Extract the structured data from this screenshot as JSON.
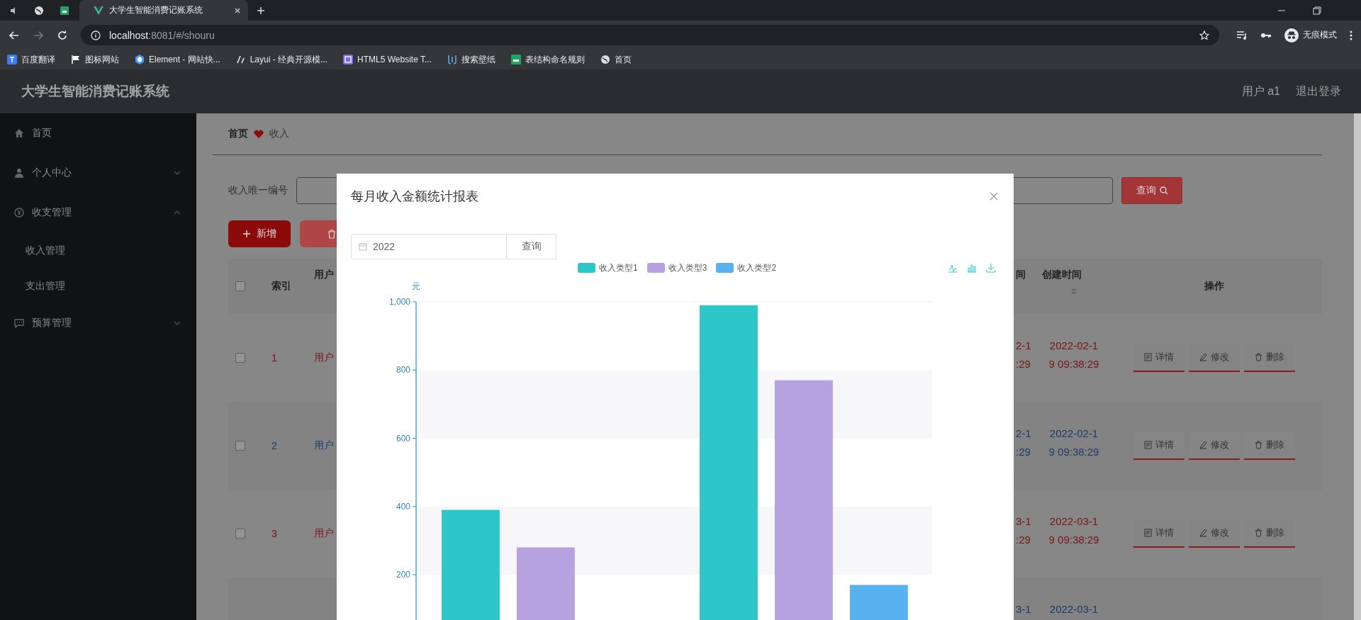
{
  "browser": {
    "tabs": [
      {
        "title": "大学生智能消费记账系统",
        "selected": true
      }
    ],
    "address": {
      "host": "localhost",
      "path": ":8081/#/shouru"
    },
    "profile": "无痕模式",
    "bookmarks": [
      {
        "label": "百度翻译",
        "kind": "translate"
      },
      {
        "label": "图标网站",
        "kind": "flag"
      },
      {
        "label": "Element - 网站快...",
        "kind": "hexagon"
      },
      {
        "label": "Layui - 经典开源模...",
        "kind": "slashes"
      },
      {
        "label": "HTML5 Website T...",
        "kind": "square"
      },
      {
        "label": "搜索壁纸",
        "kind": "brackets"
      },
      {
        "label": "表结构命名规则",
        "kind": "sheet"
      },
      {
        "label": "首页",
        "kind": "globe"
      }
    ]
  },
  "app": {
    "title": "大学生智能消费记账系统",
    "user": "用户 a1",
    "logout": "退出登录"
  },
  "sidebar": {
    "items": [
      {
        "label": "首页",
        "kind": "home"
      },
      {
        "label": "个人中心",
        "kind": "user",
        "expanded": false
      },
      {
        "label": "收支管理",
        "kind": "coin",
        "expanded": true,
        "children": [
          {
            "label": "收入管理"
          },
          {
            "label": "支出管理"
          }
        ]
      },
      {
        "label": "预算管理",
        "kind": "chat",
        "expanded": false
      }
    ]
  },
  "breadcrumb": [
    "首页",
    "收入"
  ],
  "search": {
    "label": "收入唯一编号",
    "button": "查询"
  },
  "toolbar": {
    "add": "新增"
  },
  "table": {
    "all_checked": false,
    "columns": [
      "索引",
      "用户",
      "间",
      "创建时间",
      "操作"
    ],
    "rows": [
      {
        "checked": false,
        "index": "1",
        "user": "用户",
        "time_end": [
          "2-1",
          ":29"
        ],
        "created": [
          "2022-02-1",
          "9 09:38:29"
        ],
        "color": "#7a1414",
        "actions": [
          "详情",
          "修改",
          "删除"
        ]
      },
      {
        "checked": false,
        "index": "2",
        "user": "用户",
        "time_end": [
          "2-1",
          ":29"
        ],
        "created": [
          "2022-02-1",
          "9 09:38:29"
        ],
        "color": "#1d3a6b",
        "actions": [
          "详情",
          "修改",
          "删除"
        ]
      },
      {
        "checked": false,
        "index": "3",
        "user": "用户",
        "time_end": [
          "3-1",
          ":29"
        ],
        "created": [
          "2022-03-1",
          "9 09:38:29"
        ],
        "color": "#7a1414",
        "actions": [
          "详情",
          "修改",
          "删除"
        ]
      },
      {
        "time_end": [
          "3-1"
        ],
        "created": [
          "2022-03-1"
        ],
        "color": "#1d3a6b"
      }
    ]
  },
  "modal": {
    "title": "每月收入金额统计报表",
    "year": "2022",
    "query": "查询",
    "chart_data": {
      "type": "bar",
      "stacked": false,
      "ylabel": "元",
      "ylim": [
        0,
        1000
      ],
      "yticks": [
        200,
        400,
        600,
        800,
        {
          "value": 1000,
          "label": "1,000"
        }
      ],
      "series": [
        {
          "name": "收入类型1",
          "color": "#2ec7c9",
          "values": [
            390,
            990
          ]
        },
        {
          "name": "收入类型3",
          "color": "#b6a2de",
          "values": [
            280,
            770
          ]
        },
        {
          "name": "收入类型2",
          "color": "#5ab1ef",
          "values": [
            null,
            170
          ]
        }
      ]
    }
  }
}
